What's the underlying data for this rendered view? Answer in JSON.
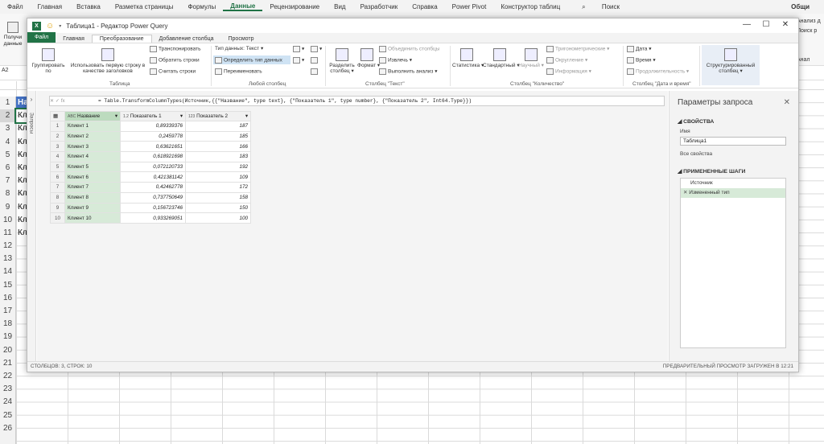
{
  "excel": {
    "menu": [
      "Файл",
      "Главная",
      "Вставка",
      "Разметка страницы",
      "Формулы",
      "Данные",
      "Рецензирование",
      "Вид",
      "Разработчик",
      "Справка",
      "Power Pivot",
      "Конструктор таблиц",
      "Поиск"
    ],
    "active_menu": "Данные",
    "share_label": "Общи",
    "ribbon_left": "Получи данные",
    "right_items": [
      "Анализ д",
      "Поиск р",
      "Анал"
    ],
    "namebox": "A2",
    "row_numbers": [
      "1",
      "2",
      "3",
      "4",
      "5",
      "6",
      "7",
      "8",
      "9",
      "10",
      "11",
      "12",
      "13",
      "14",
      "15",
      "16",
      "17",
      "18",
      "19",
      "20",
      "21",
      "22",
      "23",
      "24",
      "25",
      "26"
    ],
    "col_cells": [
      "На",
      "Кл",
      "Кл",
      "Кл",
      "Кл",
      "Кл",
      "Кл",
      "Кл",
      "Кл",
      "Кл",
      "Кл"
    ]
  },
  "pq": {
    "title": "Таблица1 - Редактор Power Query",
    "tabs": [
      "Файл",
      "Главная",
      "Преобразование",
      "Добавление столбца",
      "Просмотр"
    ],
    "active_tab": "Преобразование",
    "ribbon": {
      "group_by": "Группировать по",
      "use_first_row": "Использовать первую строку в качестве заголовков",
      "transpose": "Транспонировать",
      "reverse_rows": "Обратить строки",
      "count_rows": "Считать строки",
      "group_table": "Таблица",
      "data_type": "Тип данных: Текст",
      "detect_type": "Определить тип данных",
      "rename": "Переименовать",
      "group_any_column": "Любой столбец",
      "split_column": "Разделить столбец",
      "format": "Формат",
      "merge_columns": "Объединить столбцы",
      "extract": "Извлечь",
      "parse": "Выполнить анализ",
      "group_text": "Столбец \"Текст\"",
      "statistics": "Статистика",
      "standard": "Стандартный",
      "scientific": "Научный",
      "trig": "Тригонометрические",
      "rounding": "Округление",
      "information": "Информация",
      "group_number": "Столбец \"Количество\"",
      "date": "Дата",
      "time": "Время",
      "duration": "Продолжительность",
      "group_datetime": "Столбец \"Дата и время\"",
      "structured": "Структурированный столбец"
    },
    "queries_label": "Запросы",
    "formula": "= Table.TransformColumnTypes(Источник,{{\"Название\", type text}, {\"Показатель 1\", type number}, {\"Показатель 2\", Int64.Type}})",
    "table": {
      "headers": [
        "Название",
        "Показатель 1",
        "Показатель 2"
      ],
      "header_types": [
        "ABC",
        "1.2",
        "123"
      ],
      "rows": [
        [
          "1",
          "Клиент 1",
          "0,89339376",
          "187"
        ],
        [
          "2",
          "Клиент 2",
          "0,2459778",
          "185"
        ],
        [
          "3",
          "Клиент 3",
          "0,63621651",
          "166"
        ],
        [
          "4",
          "Клиент 4",
          "0,618921698",
          "183"
        ],
        [
          "5",
          "Клиент 5",
          "0,072120733",
          "192"
        ],
        [
          "6",
          "Клиент 6",
          "0,421381142",
          "109"
        ],
        [
          "7",
          "Клиент 7",
          "0,42462778",
          "172"
        ],
        [
          "8",
          "Клиент 8",
          "0,737750649",
          "158"
        ],
        [
          "9",
          "Клиент 9",
          "0,156723746",
          "150"
        ],
        [
          "10",
          "Клиент 10",
          "0,933269051",
          "100"
        ]
      ]
    },
    "status_left": "СТОЛБЦОВ: 3, СТРОК: 10",
    "status_right": "ПРЕДВАРИТЕЛЬНЫЙ ПРОСМОТР ЗАГРУЖЕН В 12:21",
    "pane": {
      "title": "Параметры запроса",
      "properties": "СВОЙСТВА",
      "name_label": "Имя",
      "name_value": "Таблица1",
      "all_props": "Все свойства",
      "applied_steps": "ПРИМЕНЕННЫЕ ШАГИ",
      "steps": [
        "Источник",
        "Измененный тип"
      ]
    }
  }
}
